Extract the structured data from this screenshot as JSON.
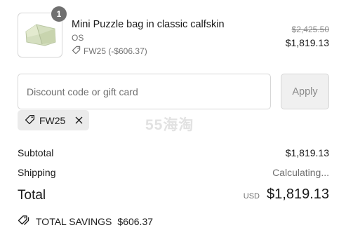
{
  "product": {
    "name": "Mini Puzzle bag in classic calfskin",
    "variant": "OS",
    "discount": "FW25 (-$606.37)",
    "original_price": "$2,425.50",
    "price": "$1,819.13",
    "quantity": "1",
    "image_color": "#d5dfc0"
  },
  "discount_form": {
    "placeholder": "Discount code or gift card",
    "apply_label": "Apply"
  },
  "applied_code": {
    "code": "FW25"
  },
  "watermark": "55海淘",
  "summary": {
    "subtotal_label": "Subtotal",
    "subtotal_value": "$1,819.13",
    "shipping_label": "Shipping",
    "shipping_value": "Calculating...",
    "total_label": "Total",
    "total_currency": "USD",
    "total_value": "$1,819.13",
    "savings_label": "TOTAL SAVINGS",
    "savings_value": "$606.37"
  }
}
